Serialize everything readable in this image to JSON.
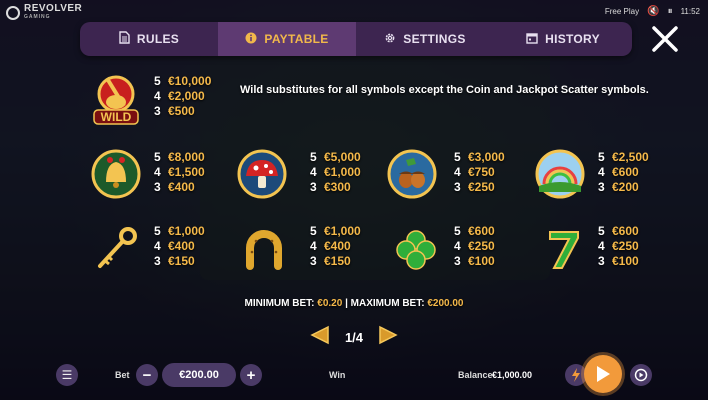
{
  "brand": {
    "name": "REVOLVER",
    "sub": "GAMING"
  },
  "system": {
    "mode": "Free Play",
    "time": "11:52"
  },
  "tabs": [
    {
      "label": "RULES",
      "icon": "document-icon"
    },
    {
      "label": "PAYTABLE",
      "icon": "info-icon",
      "active": true
    },
    {
      "label": "SETTINGS",
      "icon": "gear-icon"
    },
    {
      "label": "HISTORY",
      "icon": "calendar-icon"
    }
  ],
  "paytable": {
    "wild_description": "Wild substitutes for all symbols except the Coin and Jackpot Scatter symbols.",
    "wild": {
      "icon": "wild-pot-icon",
      "badge": "WILD",
      "pays": [
        [
          "5",
          "€10,000"
        ],
        [
          "4",
          "€2,000"
        ],
        [
          "3",
          "€500"
        ]
      ]
    },
    "symbols": [
      {
        "icon": "bell-icon",
        "pays": [
          [
            "5",
            "€8,000"
          ],
          [
            "4",
            "€1,500"
          ],
          [
            "3",
            "€400"
          ]
        ]
      },
      {
        "icon": "mushroom-icon",
        "pays": [
          [
            "5",
            "€5,000"
          ],
          [
            "4",
            "€1,000"
          ],
          [
            "3",
            "€300"
          ]
        ]
      },
      {
        "icon": "acorn-icon",
        "pays": [
          [
            "5",
            "€3,000"
          ],
          [
            "4",
            "€750"
          ],
          [
            "3",
            "€250"
          ]
        ]
      },
      {
        "icon": "rainbow-icon",
        "pays": [
          [
            "5",
            "€2,500"
          ],
          [
            "4",
            "€600"
          ],
          [
            "3",
            "€200"
          ]
        ]
      },
      {
        "icon": "key-icon",
        "pays": [
          [
            "5",
            "€1,000"
          ],
          [
            "4",
            "€400"
          ],
          [
            "3",
            "€150"
          ]
        ]
      },
      {
        "icon": "horseshoe-icon",
        "pays": [
          [
            "5",
            "€1,000"
          ],
          [
            "4",
            "€400"
          ],
          [
            "3",
            "€150"
          ]
        ]
      },
      {
        "icon": "clover-icon",
        "pays": [
          [
            "5",
            "€600"
          ],
          [
            "4",
            "€250"
          ],
          [
            "3",
            "€100"
          ]
        ]
      },
      {
        "icon": "seven-icon",
        "pays": [
          [
            "5",
            "€600"
          ],
          [
            "4",
            "€250"
          ],
          [
            "3",
            "€100"
          ]
        ]
      }
    ],
    "min_bet_label": "MINIMUM BET:",
    "min_bet": "€0.20",
    "separator": "|",
    "max_bet_label": "MAXIMUM BET:",
    "max_bet": "€200.00",
    "page": "1/4"
  },
  "bottom": {
    "bet_label": "Bet",
    "bet_value": "€200.00",
    "win_label": "Win",
    "balance_label": "Balance",
    "balance_value": "€1,000.00"
  },
  "colors": {
    "accent": "#f5b94a",
    "panel": "#3d2550",
    "panel_active": "#5e3a72",
    "spin": "#f29a3b"
  }
}
